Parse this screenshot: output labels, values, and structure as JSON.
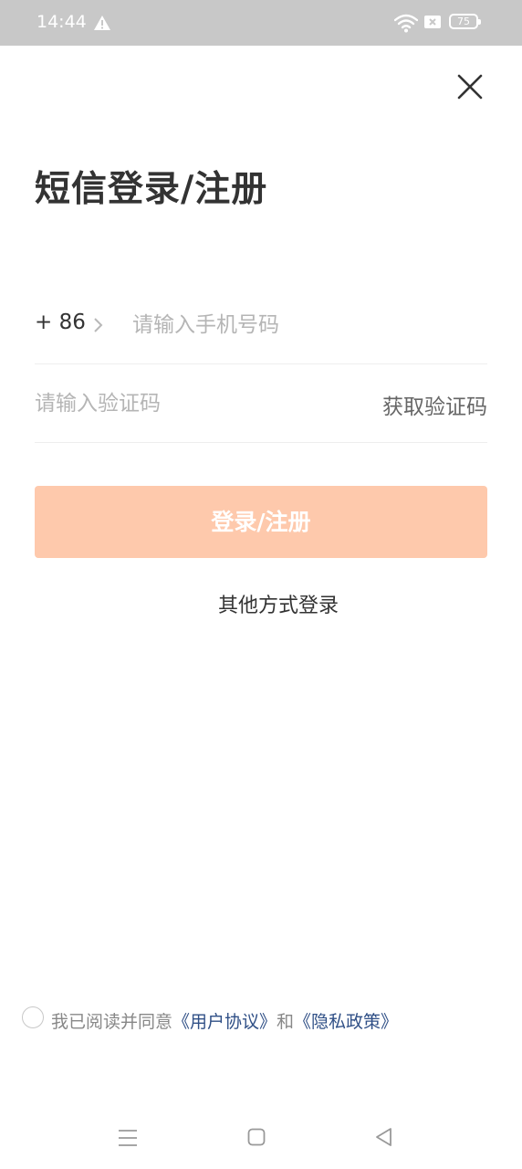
{
  "status_bar": {
    "time": "14:44",
    "battery": "75",
    "icons": [
      "warning-icon",
      "wifi-icon",
      "sim-icon",
      "battery-icon"
    ]
  },
  "header": {
    "close_icon": "close-icon"
  },
  "title": "短信登录/注册",
  "phone": {
    "country_code": "+ 86",
    "placeholder": "请输入手机号码",
    "value": ""
  },
  "code": {
    "placeholder": "请输入验证码",
    "value": "",
    "get_code_label": "获取验证码"
  },
  "login_button": {
    "label": "登录/注册",
    "color": "#fec9ac"
  },
  "other_login_label": "其他方式登录",
  "agreement": {
    "prefix": "我已阅读并同意",
    "user_agreement": "《用户协议》",
    "and": "和",
    "privacy_policy": "《隐私政策》",
    "checked": false,
    "link_color": "#2f4f86"
  },
  "nav_bar": {
    "icons": [
      "menu-icon",
      "home-icon",
      "back-icon"
    ]
  }
}
